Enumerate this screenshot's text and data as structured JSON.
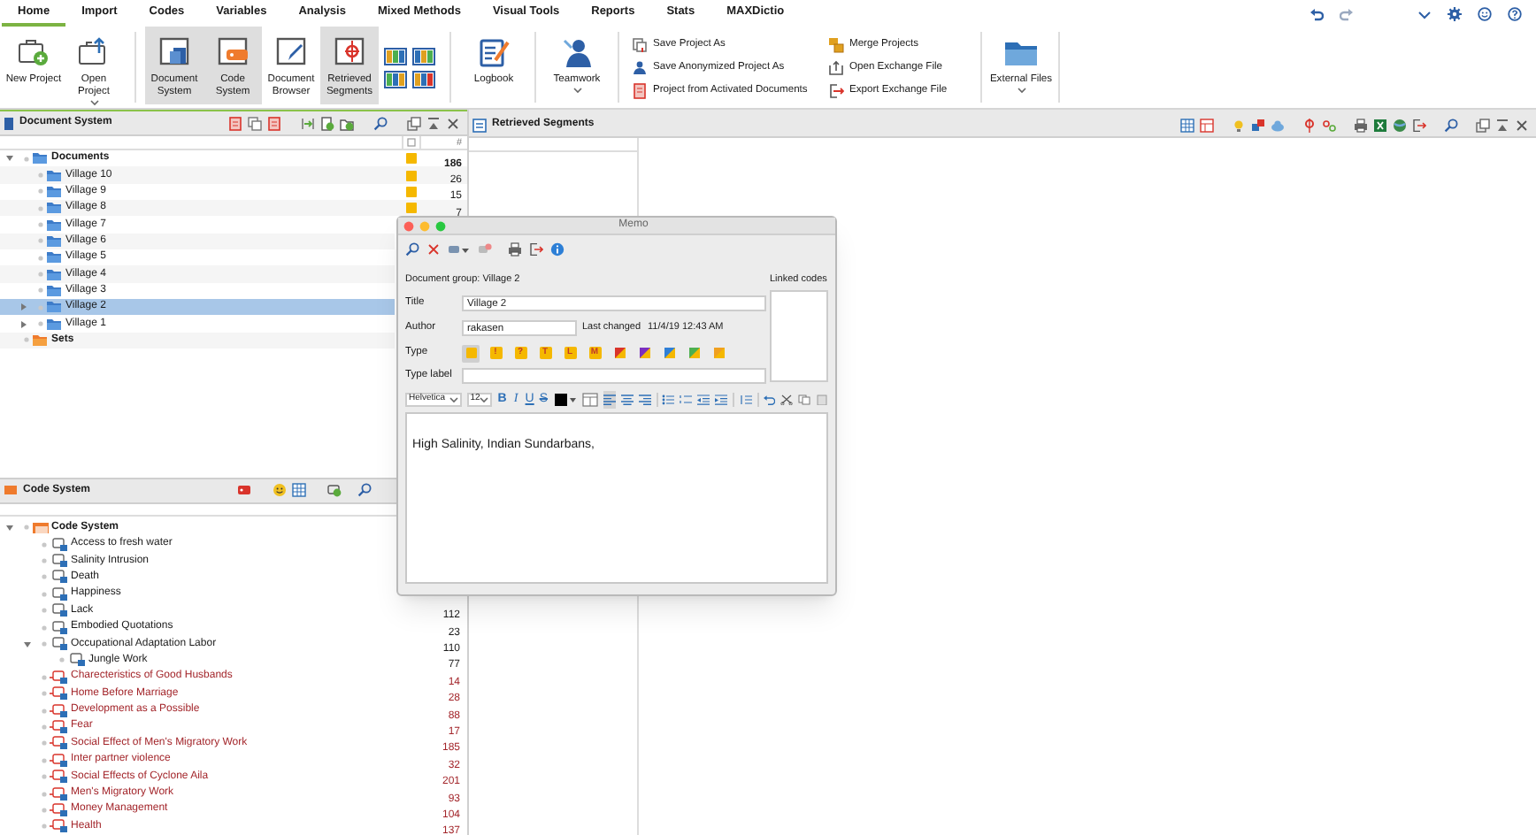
{
  "menu_tabs": [
    {
      "label": "Home",
      "selected": true
    },
    {
      "label": "Import",
      "selected": false
    },
    {
      "label": "Codes",
      "selected": false
    },
    {
      "label": "Variables",
      "selected": false
    },
    {
      "label": "Analysis",
      "selected": false
    },
    {
      "label": "Mixed Methods",
      "selected": false
    },
    {
      "label": "Visual Tools",
      "selected": false
    },
    {
      "label": "Reports",
      "selected": false
    },
    {
      "label": "Stats",
      "selected": false
    },
    {
      "label": "MAXDictio",
      "selected": false
    }
  ],
  "ribbon": {
    "buttons": [
      {
        "kind": "new_project",
        "label": "New Project",
        "selected": false,
        "has_menu": false
      },
      {
        "kind": "open_project",
        "label": "Open Project",
        "selected": false,
        "has_menu": true
      },
      {
        "kind": "document_system",
        "label": "Document System",
        "selected": true,
        "has_menu": false
      },
      {
        "kind": "code_system",
        "label": "Code System",
        "selected": true,
        "has_menu": false
      },
      {
        "kind": "document_browser",
        "label": "Document Browser",
        "selected": false,
        "has_menu": false
      },
      {
        "kind": "retrieved_segments",
        "label": "Retrieved Segments",
        "selected": true,
        "has_menu": false
      }
    ],
    "tools": [
      {
        "kind": "logbook",
        "label": "Logbook",
        "has_menu": false
      },
      {
        "kind": "teamwork",
        "label": "Teamwork",
        "has_menu": true
      }
    ],
    "commands": [
      [
        "Save Project As",
        "Save Anonymized Project As",
        "Project from Activated Documents"
      ],
      [
        "Merge Projects",
        "Open Exchange File",
        "Export Exchange File"
      ]
    ],
    "external": {
      "label": "External Files",
      "has_menu": true
    }
  },
  "document_system": {
    "title": "Document System",
    "count_header": "#",
    "tree": [
      {
        "label": "Documents",
        "kind": "folder",
        "expanded": true,
        "memo": true,
        "count": "186",
        "selected": false,
        "children": [
          {
            "label": "Village 10",
            "kind": "folder",
            "memo": true,
            "count": "26",
            "selected": false
          },
          {
            "label": "Village 9",
            "kind": "folder",
            "memo": true,
            "count": "15",
            "selected": false
          },
          {
            "label": "Village 8",
            "kind": "folder",
            "memo": true,
            "count": "7",
            "selected": false
          },
          {
            "label": "Village 7",
            "kind": "folder",
            "selected": false
          },
          {
            "label": "Village 6",
            "kind": "folder",
            "selected": false
          },
          {
            "label": "Village 5",
            "kind": "folder",
            "selected": false
          },
          {
            "label": "Village 4",
            "kind": "folder",
            "selected": false
          },
          {
            "label": "Village 3",
            "kind": "folder",
            "selected": false
          },
          {
            "label": "Village 2",
            "kind": "folder",
            "expanded": false,
            "selected": true
          },
          {
            "label": "Village 1",
            "kind": "folder",
            "expanded": false,
            "selected": false
          }
        ]
      },
      {
        "label": "Sets",
        "kind": "set",
        "selected": false
      }
    ]
  },
  "code_system": {
    "title": "Code System",
    "tree": [
      {
        "label": "Code System",
        "color": "#1a1a1a",
        "expanded": true,
        "children": [
          {
            "label": "Access to fresh water",
            "color": "#1a1a1a"
          },
          {
            "label": "Salinity Intrusion",
            "color": "#1a1a1a"
          },
          {
            "label": "Death",
            "color": "#1a1a1a"
          },
          {
            "label": "Happiness",
            "color": "#1a1a1a"
          },
          {
            "label": "Lack",
            "color": "#1a1a1a",
            "count": "112"
          },
          {
            "label": "Embodied Quotations",
            "color": "#1a1a1a",
            "count": "23"
          },
          {
            "label": "Occupational Adaptation Labor",
            "color": "#1a1a1a",
            "expanded": true,
            "count": "110",
            "children": [
              {
                "label": "Jungle Work",
                "color": "#1a1a1a",
                "count": "77"
              }
            ]
          },
          {
            "label": "Charecteristics of Good Husbands",
            "color": "#a3262b",
            "count": "14"
          },
          {
            "label": "Home Before Marriage",
            "color": "#a3262b",
            "count": "28"
          },
          {
            "label": "Development as a Possible",
            "color": "#a3262b",
            "count": "88"
          },
          {
            "label": "Fear",
            "color": "#a3262b",
            "count": "17"
          },
          {
            "label": "Social Effect of Men's Migratory Work",
            "color": "#a3262b",
            "count": "185"
          },
          {
            "label": "Inter partner violence",
            "color": "#a3262b",
            "count": "32"
          },
          {
            "label": "Social Effects of Cyclone Aila",
            "color": "#a3262b",
            "count": "201"
          },
          {
            "label": "Men's Migratory Work",
            "color": "#a3262b",
            "count": "93"
          },
          {
            "label": "Money Management",
            "color": "#a3262b",
            "count": "104"
          },
          {
            "label": "Health",
            "color": "#a3262b",
            "count": "137"
          }
        ]
      }
    ]
  },
  "retrieved_segments": {
    "title": "Retrieved Segments"
  },
  "memo": {
    "title": "Memo",
    "document_group": "Document group: Village 2",
    "linked_codes_label": "Linked codes",
    "title_label": "Title",
    "title_value": "Village 2",
    "author_label": "Author",
    "author_value": "rakasen",
    "last_changed_label": "Last changed",
    "last_changed_value": "11/4/19 12:43 AM",
    "type_label": "Type",
    "type_name_label": "Type label",
    "types": [
      {
        "kind": "plain",
        "selected": true
      },
      {
        "kind": "letter",
        "symbol": "!",
        "selected": false
      },
      {
        "kind": "letter",
        "symbol": "?",
        "selected": false
      },
      {
        "kind": "letter",
        "symbol": "T",
        "selected": false
      },
      {
        "kind": "letter",
        "symbol": "L",
        "selected": false
      },
      {
        "kind": "letter",
        "symbol": "M",
        "selected": false
      },
      {
        "kind": "split",
        "color": "#d9342b",
        "selected": false
      },
      {
        "kind": "split",
        "color": "#7b2fc0",
        "selected": false
      },
      {
        "kind": "split",
        "color": "#2f7fd6",
        "selected": false
      },
      {
        "kind": "split",
        "color": "#4caf50",
        "selected": false
      },
      {
        "kind": "split",
        "color": "#f0a020",
        "selected": false
      }
    ],
    "font": "Helvetica",
    "size": "12",
    "format_buttons": [
      {
        "label": "B",
        "kind": "bold"
      },
      {
        "label": "I",
        "kind": "italic"
      },
      {
        "label": "U",
        "kind": "underline"
      },
      {
        "label": "S",
        "kind": "strike"
      }
    ],
    "align": [
      {
        "selected": true
      },
      {
        "selected": false
      },
      {
        "selected": false
      }
    ],
    "body": "High Salinity, Indian Sundarbans,"
  }
}
